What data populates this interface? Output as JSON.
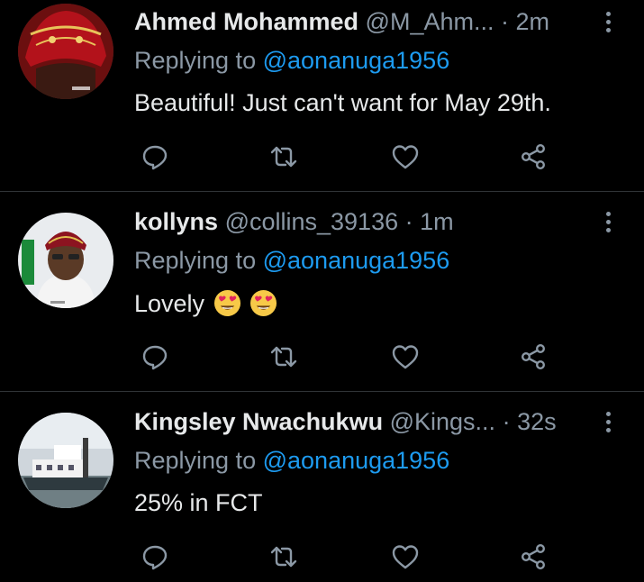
{
  "tweets": [
    {
      "name": "Ahmed Mohammed",
      "handle": "@M_Ahm...",
      "dot": "·",
      "time": "2m",
      "replying_prefix": "Replying to",
      "replying_to": "@aonanuga1956",
      "text": "Beautiful! Just can't want for May 29th.",
      "avatar_icon": "avatar-red-cap-photo"
    },
    {
      "name": "kollyns",
      "handle": "@collins_39136",
      "dot": "·",
      "time": "1m",
      "replying_prefix": "Replying to",
      "replying_to": "@aonanuga1956",
      "text": "Lovely",
      "emoji": [
        "heart-eyes-emoji",
        "heart-eyes-emoji"
      ],
      "avatar_icon": "avatar-man-with-cap-photo"
    },
    {
      "name": "Kingsley Nwachukwu",
      "handle": "@Kings...",
      "dot": "·",
      "time": "32s",
      "replying_prefix": "Replying to",
      "replying_to": "@aonanuga1956",
      "text": "25% in FCT",
      "avatar_icon": "avatar-boat-photo"
    }
  ],
  "colors": {
    "background": "#000000",
    "primary_text": "#e7e9ea",
    "secondary_text": "#8b98a5",
    "mention": "#1d9bf0",
    "divider": "#2f3336"
  },
  "action_icons": [
    "reply-icon",
    "retweet-icon",
    "like-icon",
    "share-icon"
  ]
}
